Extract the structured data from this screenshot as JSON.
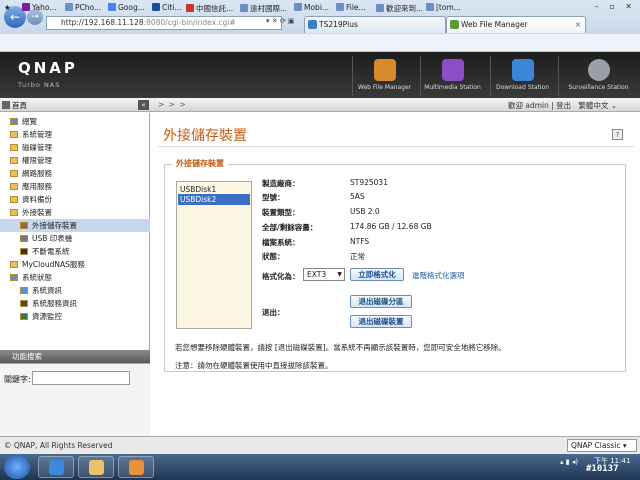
{
  "browser": {
    "address": "http://192.168.11.128:8080/cgi-bin/index.cgi#",
    "address_host": "http://192.168.11.128",
    "address_rest": ":8080/cgi-bin/index.cgi#",
    "tabs": [
      {
        "label": "TS219Plus"
      },
      {
        "label": "Web File Manager"
      }
    ],
    "favorites": [
      "Yaho...",
      "PCho...",
      "Goog...",
      "Citi...",
      "中國信託...",
      "遠村國際...",
      "Mobi...",
      "File...",
      "歡迎來到...",
      "[tom..."
    ]
  },
  "header": {
    "logo": "QNAP",
    "logo_sub": "Turbo NAS",
    "stations": [
      {
        "label": "Web File Manager",
        "icon": "file-manager-icon",
        "color": "#d98a2b"
      },
      {
        "label": "Multimedia Station",
        "icon": "multimedia-icon",
        "color": "#8a4fc4"
      },
      {
        "label": "Download Station",
        "icon": "download-icon",
        "color": "#3b85d6"
      },
      {
        "label": "Surveillance Station",
        "icon": "camera-icon",
        "color": "#9aa0a8"
      }
    ]
  },
  "nav": {
    "home": "首頁",
    "breadcrumb": "> > >",
    "welcome": "歡迎 admin | 登出",
    "language": "繁體中文"
  },
  "sidebar": {
    "items": [
      {
        "label": "總覽",
        "level": 0
      },
      {
        "label": "系統管理",
        "level": 0
      },
      {
        "label": "磁碟管理",
        "level": 0
      },
      {
        "label": "權限管理",
        "level": 0
      },
      {
        "label": "網路服務",
        "level": 0
      },
      {
        "label": "應用服務",
        "level": 0
      },
      {
        "label": "資料備份",
        "level": 0
      },
      {
        "label": "外接裝置",
        "level": 0
      },
      {
        "label": "外接儲存裝置",
        "level": 1
      },
      {
        "label": "USB 印表機",
        "level": 1
      },
      {
        "label": "不斷電系統",
        "level": 1
      },
      {
        "label": "MyCloudNAS服務",
        "level": 0
      },
      {
        "label": "系統狀態",
        "level": 0
      },
      {
        "label": "系統資訊",
        "level": 1
      },
      {
        "label": "系統服務資訊",
        "level": 1
      },
      {
        "label": "資源監控",
        "level": 1
      }
    ],
    "selected_index": 8,
    "search_panel_title": "功能搜索",
    "search_label": "關鍵字:",
    "search_value": ""
  },
  "main": {
    "title": "外接儲存裝置",
    "section": "外接儲存裝置",
    "disks": [
      "USBDisk1",
      "USBDisk2"
    ],
    "selected_disk": 1,
    "props": [
      {
        "label": "製造廠商：",
        "value": "ST925031"
      },
      {
        "label": "型號：",
        "value": "5AS"
      },
      {
        "label": "裝置類型：",
        "value": "USB 2.0"
      },
      {
        "label": "全部/剩餘容量：",
        "value": "174.86 GB / 12.68 GB"
      },
      {
        "label": "檔案系統：",
        "value": "NTFS"
      },
      {
        "label": "狀態：",
        "value": "正常"
      }
    ],
    "format_label": "格式化為：",
    "format_value": "EXT3",
    "format_button": "立即格式化",
    "advanced_link": "進階格式化選項",
    "eject_label": "退出：",
    "eject_partition_button": "退出磁碟分區",
    "eject_device_button": "退出磁碟裝置",
    "note1": "若您想要移除硬體裝置，請按 [退出磁碟裝置]。當系統不再顯示該裝置時，您即可安全地將它移除。",
    "note2": "注意：請勿在硬體裝置使用中直接拔除該裝置。"
  },
  "footer": {
    "copyright": "© QNAP, All Rights Reserved",
    "theme": "QNAP Classic"
  },
  "taskbar": {
    "time": "下午 11:41",
    "date": "2...",
    "tag": "#10137"
  }
}
